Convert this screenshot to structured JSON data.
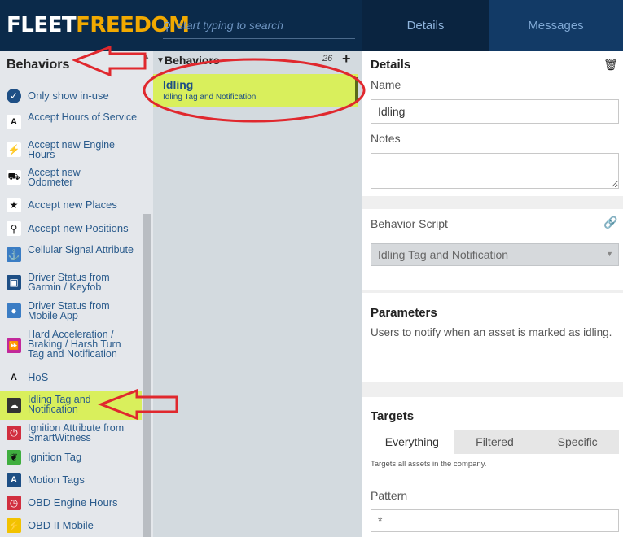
{
  "topbar": {
    "logo_part1": "FLEET",
    "logo_part2": "FREEDOM",
    "search_placeholder": "start typing to search",
    "tabs": [
      {
        "label": "Details"
      },
      {
        "label": "Messages"
      }
    ]
  },
  "sidebar": {
    "header": "Behaviors",
    "items": [
      {
        "label": "Only show in-use",
        "icon": "check-circle-icon",
        "color": "#1e4f85"
      },
      {
        "label": "Accept Hours of Service",
        "icon": "hos-icon",
        "color": "#ffffff"
      },
      {
        "label": "Accept new Engine Hours",
        "icon": "bolt-icon",
        "color": "#ffffff"
      },
      {
        "label": "Accept new Odometer",
        "icon": "car-icon",
        "color": "#ffffff"
      },
      {
        "label": "Accept new Places",
        "icon": "star-icon",
        "color": "#ffffff"
      },
      {
        "label": "Accept new Positions",
        "icon": "map-pin-icon",
        "color": "#ffffff"
      },
      {
        "label": "Cellular Signal Attribute",
        "icon": "anchor-icon",
        "color": "#3b7dc4"
      },
      {
        "label": "Driver Status from Garmin / Keyfob",
        "icon": "device-icon",
        "color": "#1e4f85"
      },
      {
        "label": "Driver Status from Mobile App",
        "icon": "person-icon",
        "color": "#3b7dc4"
      },
      {
        "label": "Hard Acceleration / Braking / Harsh Turn Tag and Notification",
        "icon": "fast-forward-icon",
        "color": "#c2299b"
      },
      {
        "label": "HoS",
        "icon": "hos-icon",
        "color": "#ffffff"
      },
      {
        "label": "Idling Tag and Notification",
        "icon": "cloud-icon",
        "color": "#333333"
      },
      {
        "label": "Ignition Attribute from SmartWitness",
        "icon": "power-icon",
        "color": "#d12f3f"
      },
      {
        "label": "Ignition Tag",
        "icon": "leaf-icon",
        "color": "#3fae3f"
      },
      {
        "label": "Motion Tags",
        "icon": "motion-icon",
        "color": "#1e4f85"
      },
      {
        "label": "OBD Engine Hours",
        "icon": "clock-icon",
        "color": "#d12f3f"
      },
      {
        "label": "OBD II Mobile",
        "icon": "plug-icon",
        "color": "#f2c200"
      }
    ]
  },
  "middle": {
    "title": "Behaviors",
    "count": "26",
    "add_label": "+",
    "selected": {
      "title": "Idling",
      "subtitle": "Idling Tag and Notification"
    }
  },
  "details": {
    "heading": "Details",
    "name_label": "Name",
    "name_value": "Idling",
    "notes_label": "Notes",
    "notes_value": "",
    "script_label": "Behavior Script",
    "script_value": "Idling Tag and Notification",
    "parameters_heading": "Parameters",
    "parameters_text": "Users to notify when an asset is marked as idling.",
    "targets_heading": "Targets",
    "targets_tabs": [
      "Everything",
      "Filtered",
      "Specific"
    ],
    "targets_active": "Everything",
    "targets_note": "Targets all assets in the company.",
    "pattern_label": "Pattern",
    "pattern_value": "*"
  },
  "colors": {
    "topbar": "#0b2a4a",
    "selection": "#d9ef5c",
    "annotation": "#e0282e",
    "link": "#1e4f85"
  }
}
